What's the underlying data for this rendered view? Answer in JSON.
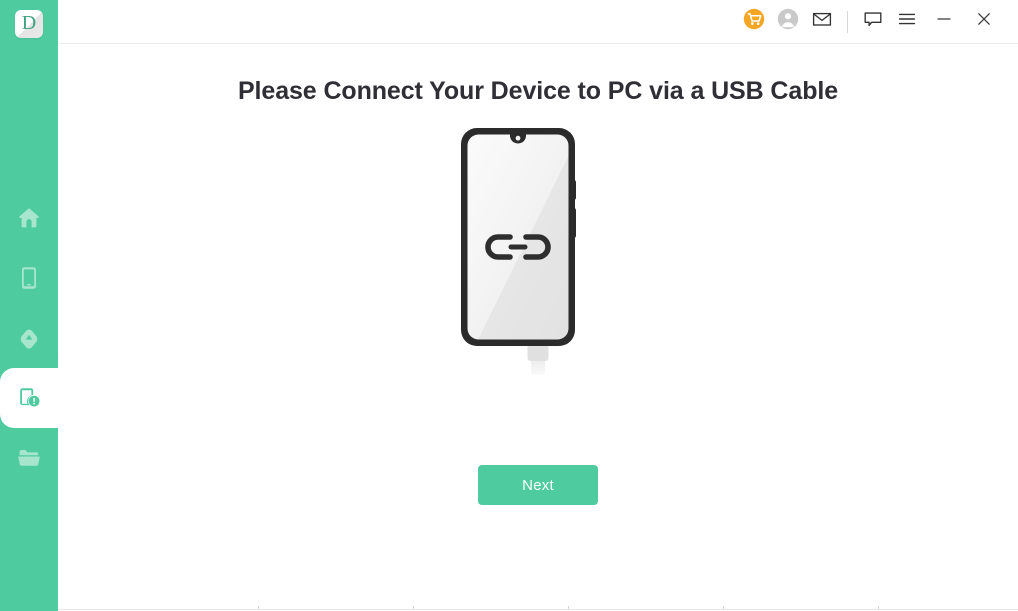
{
  "app": {
    "logo_letter": "D",
    "accent_color": "#4ECB9F",
    "cart_color": "#F5A623",
    "title_color": "#2f2f35"
  },
  "sidebar": {
    "items": [
      {
        "name": "home",
        "icon": "home-icon",
        "active": false
      },
      {
        "name": "device",
        "icon": "phone-icon",
        "active": false
      },
      {
        "name": "backup",
        "icon": "cloud-shield-icon",
        "active": false
      },
      {
        "name": "repair",
        "icon": "phone-alert-icon",
        "active": true
      },
      {
        "name": "files",
        "icon": "folder-icon",
        "active": false
      }
    ]
  },
  "titlebar": {
    "buttons": [
      {
        "name": "cart",
        "icon": "shopping-cart-icon"
      },
      {
        "name": "account",
        "icon": "user-avatar-icon"
      },
      {
        "name": "mail",
        "icon": "envelope-icon"
      },
      {
        "name": "feedback",
        "icon": "speech-bubble-icon"
      },
      {
        "name": "menu",
        "icon": "hamburger-menu-icon"
      }
    ],
    "window_controls": [
      {
        "name": "minimize",
        "icon": "minimize-icon"
      },
      {
        "name": "close",
        "icon": "close-icon"
      }
    ]
  },
  "main": {
    "title": "Please Connect Your Device to PC via a USB Cable",
    "illustration": {
      "name": "phone-usb-illustration",
      "screen_icon": "chain-link-icon",
      "body_color": "#2b2b2b",
      "screen_color": "#ececec",
      "cable_color": "#d7d7d7"
    },
    "next_label": "Next"
  }
}
